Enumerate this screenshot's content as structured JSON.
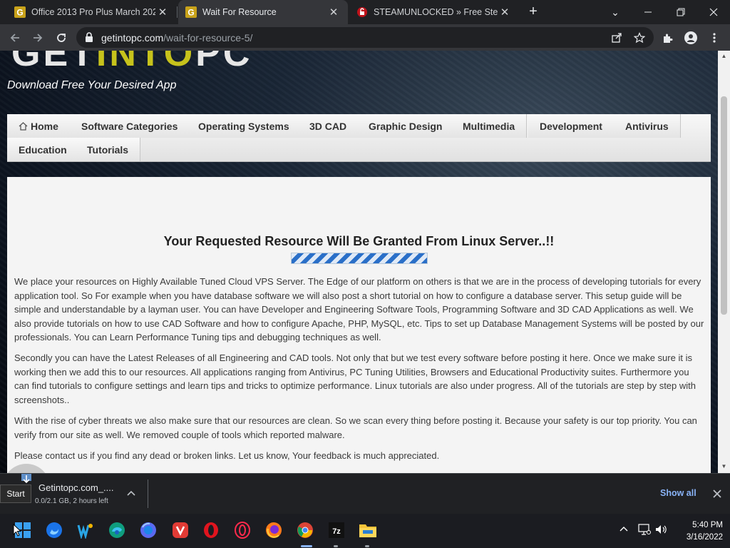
{
  "browser": {
    "tabs": [
      {
        "title": "Office 2013 Pro Plus March 2022",
        "active": false
      },
      {
        "title": "Wait For Resource",
        "active": true
      },
      {
        "title": "STEAMUNLOCKED » Free Steam",
        "active": false
      }
    ],
    "url_host": "getintopc.com",
    "url_path": "/wait-for-resource-5/"
  },
  "site": {
    "tagline": "Download Free Your Desired App",
    "menu": [
      "Home",
      "Software Categories",
      "Operating Systems",
      "3D CAD",
      "Graphic Design",
      "Multimedia",
      "Development",
      "Antivirus",
      "Education",
      "Tutorials"
    ]
  },
  "content": {
    "headline": "Your Requested Resource Will Be Granted From Linux Server..!!",
    "paragraphs": [
      "We place your resources on Highly Available Tuned Cloud VPS Server. The Edge of our platform on others is that we are in the process of developing tutorials for every application tool. So For example when you have database software we will also post a short tutorial on how to configure a database server. This setup guide will be simple and understandable by a layman user. You can have Developer and Engineering Software Tools, Programming Software and 3D CAD Applications as well. We also provide tutorials on how to use CAD Software and how to configure Apache, PHP, MySQL, etc. Tips to set up Database Management Systems will be posted by our professionals. You can Learn Performance Tuning tips and debugging techniques as well.",
      "Secondly you can have the Latest Releases of all Engineering and CAD tools. Not only that but we test every software before posting it here. Once we make sure it is working then we add this to our resources. All applications ranging from Antivirus, PC Tuning Utilities, Browsers and Educational Productivity suites. Furthermore you can find tutorials to configure settings and learn tips and tricks to optimize performance. Linux tutorials are also under progress. All of the tutorials are step by step with screenshots..",
      "With the rise of cyber threats we also make sure that our resources are clean. So we scan every thing before posting it. Because your safety is our top priority. You can verify from our site as well. We removed couple of tools which reported malware.",
      "Please contact us if you find any dead or broken links. Let us know, Your feedback is much appreciated."
    ]
  },
  "downloads": {
    "file_name": "Getintopc.com_....",
    "status": "0.0/2.1 GB, 2 hours left",
    "show_all": "Show all"
  },
  "tooltip": {
    "start": "Start"
  },
  "taskbar": {
    "apps": [
      "start-menu",
      "firefox",
      "winamp-like",
      "edge",
      "firefox-dev",
      "vivaldi",
      "opera",
      "opera-gx",
      "firefox-alt",
      "chrome",
      "7zip",
      "file-explorer"
    ],
    "time": "5:40 PM",
    "date": "3/16/2022"
  }
}
